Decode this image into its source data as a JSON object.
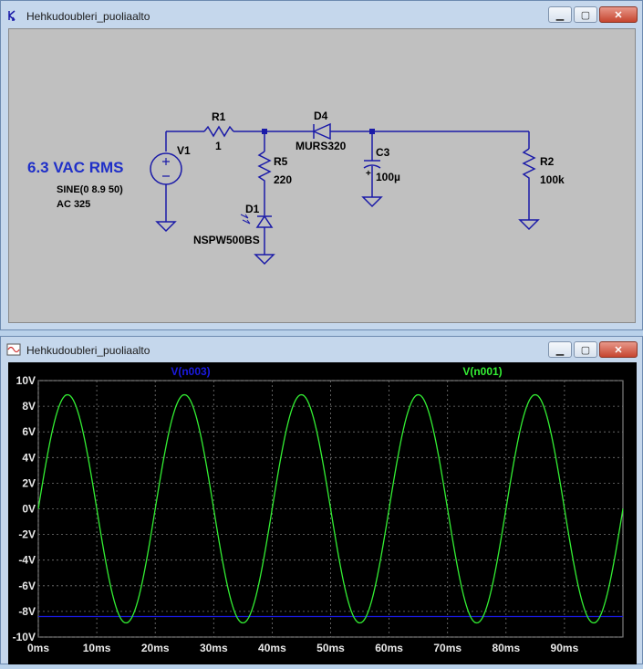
{
  "schematic_window": {
    "title": "Hehkudoubleri_puoliaalto",
    "controls": {
      "minimize": "▁",
      "maximize": "▢",
      "close": "✕"
    },
    "components": {
      "v1_name": "V1",
      "v1_label": "6.3 VAC RMS",
      "v1_value1": "SINE(0 8.9 50)",
      "v1_value2": "AC 325",
      "r1_name": "R1",
      "r1_value": "1",
      "r5_name": "R5",
      "r5_value": "220",
      "d1_name": "D1",
      "d1_value": "NSPW500BS",
      "d4_name": "D4",
      "d4_value": "MURS320",
      "c3_name": "C3",
      "c3_value": "100µ",
      "c3_plus": "+",
      "r2_name": "R2",
      "r2_value": "100k"
    },
    "colors": {
      "wire": "#1a1aa8",
      "label_blue": "#1f2fc8",
      "canvas": "#c0c0c0"
    }
  },
  "plot_window": {
    "title": "Hehkudoubleri_puoliaalto",
    "controls": {
      "minimize": "▁",
      "maximize": "▢",
      "close": "✕"
    }
  },
  "chart_data": {
    "type": "line",
    "xlabel": "",
    "ylabel": "",
    "xlim": [
      0,
      100
    ],
    "ylim": [
      -10,
      10
    ],
    "x_ticks": [
      "0ms",
      "10ms",
      "20ms",
      "30ms",
      "40ms",
      "50ms",
      "60ms",
      "70ms",
      "80ms",
      "90ms"
    ],
    "x_tick_values": [
      0,
      10,
      20,
      30,
      40,
      50,
      60,
      70,
      80,
      90
    ],
    "y_ticks": [
      "10V",
      "8V",
      "6V",
      "4V",
      "2V",
      "0V",
      "-2V",
      "-4V",
      "-6V",
      "-8V",
      "-10V"
    ],
    "y_tick_values": [
      10,
      8,
      6,
      4,
      2,
      0,
      -2,
      -4,
      -6,
      -8,
      -10
    ],
    "grid": true,
    "series": [
      {
        "name": "V(n003)",
        "color": "#1a1ae0",
        "type": "constant",
        "value": -8.4
      },
      {
        "name": "V(n001)",
        "color": "#33ee33",
        "type": "sine",
        "amplitude": 8.9,
        "frequency_hz": 50,
        "offset": 0,
        "x": [
          0,
          5,
          10,
          15,
          20,
          25,
          30,
          35,
          40,
          45,
          50,
          55,
          60,
          65,
          70,
          75,
          80,
          85,
          90,
          95,
          100
        ],
        "y": [
          0,
          8.9,
          0,
          -8.9,
          0,
          8.9,
          0,
          -8.9,
          0,
          8.9,
          0,
          -8.9,
          0,
          8.9,
          0,
          -8.9,
          0,
          8.9,
          0,
          -8.9,
          0
        ]
      }
    ]
  }
}
